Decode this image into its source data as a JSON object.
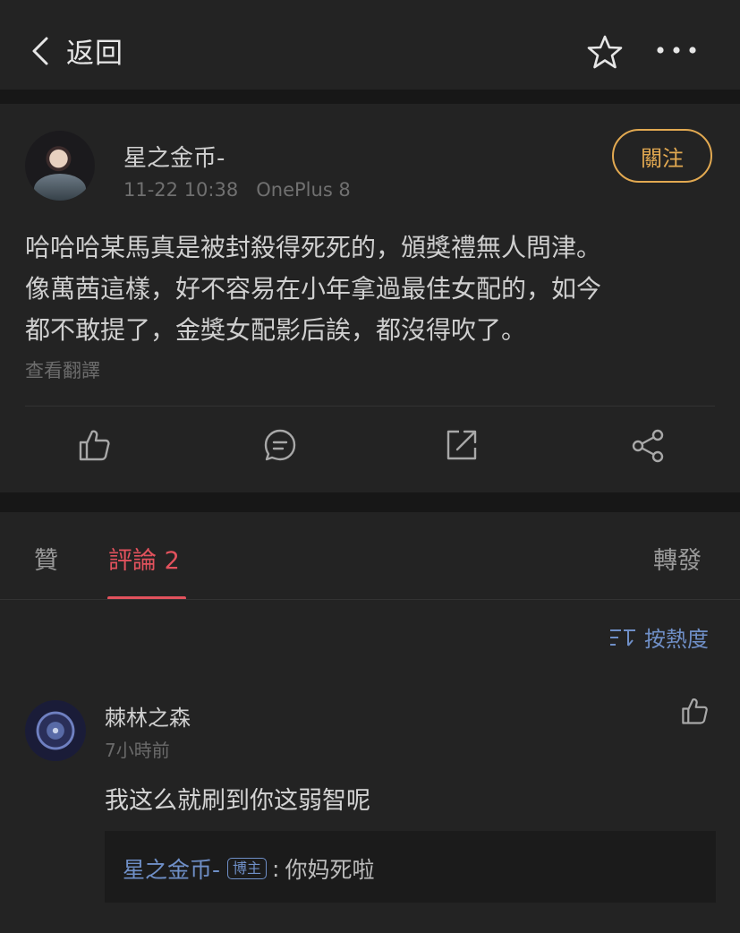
{
  "nav": {
    "back_label": "返回"
  },
  "post": {
    "author": "星之金币-",
    "time": "11-22 10:38",
    "device": "OnePlus 8",
    "follow_label": "關注",
    "content_lines": [
      "哈哈哈某馬真是被封殺得死死的，頒獎禮無人問津。",
      "像萬茜這樣，好不容易在小年拿過最佳女配的，如今",
      "都不敢提了，金獎女配影后誒，都沒得吹了。"
    ],
    "translate_label": "查看翻譯"
  },
  "tabs": {
    "like": "贊",
    "comments": "評論 2",
    "repost": "轉發"
  },
  "sort_label": "按熱度",
  "comment": {
    "author": "棘林之森",
    "time": "7小時前",
    "text": "我这么就刷到你这弱智呢",
    "reply": {
      "author": "星之金币-",
      "badge": "博主",
      "separator": ":",
      "text": "你妈死啦"
    }
  },
  "colors": {
    "accent_red": "#e2525d",
    "follow_gold": "#e2a951",
    "link_blue": "#6f8fc7"
  }
}
